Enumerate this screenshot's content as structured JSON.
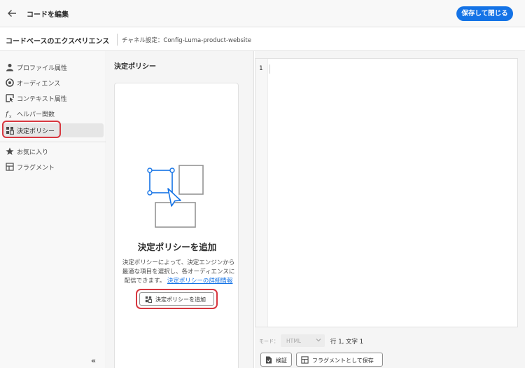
{
  "topbar": {
    "title": "コードを編集",
    "save_close_label": "保存して閉じる"
  },
  "subheader": {
    "experience_title": "コードベースのエクスペリエンス",
    "channel_text": "チャネル設定：Config-Luma-product-website"
  },
  "sidebar": {
    "items": [
      {
        "label": "プロファイル属性",
        "icon": "person-icon"
      },
      {
        "label": "オーディエンス",
        "icon": "audience-icon"
      },
      {
        "label": "コンテキスト属性",
        "icon": "context-icon"
      },
      {
        "label": "ヘルパー関数",
        "icon": "function-icon"
      },
      {
        "label": "決定ポリシー",
        "icon": "decision-icon",
        "selected": true
      }
    ],
    "extra_items": [
      {
        "label": "お気に入り",
        "icon": "star-icon"
      },
      {
        "label": "フラグメント",
        "icon": "fragment-icon"
      }
    ],
    "collapse_label": "«"
  },
  "panel": {
    "title": "決定ポリシー",
    "empty_title": "決定ポリシーを追加",
    "empty_desc_1": "決定ポリシーによって、決定エンジンから",
    "empty_desc_2": "最適な項目を選択し、各オーディエンスに",
    "empty_desc_3": "配信できます。",
    "learn_more": "決定ポリシーの詳細情報",
    "add_button_label": "決定ポリシーを追加"
  },
  "editor": {
    "line_number": "1",
    "mode_label": "モード：",
    "mode_value": "HTML",
    "cursor_position": "行 1, 文字 1",
    "validate_label": "検証",
    "save_fragment_label": "フラグメントとして保存"
  },
  "colors": {
    "accent": "#1473e6",
    "highlight": "#d7373f"
  }
}
